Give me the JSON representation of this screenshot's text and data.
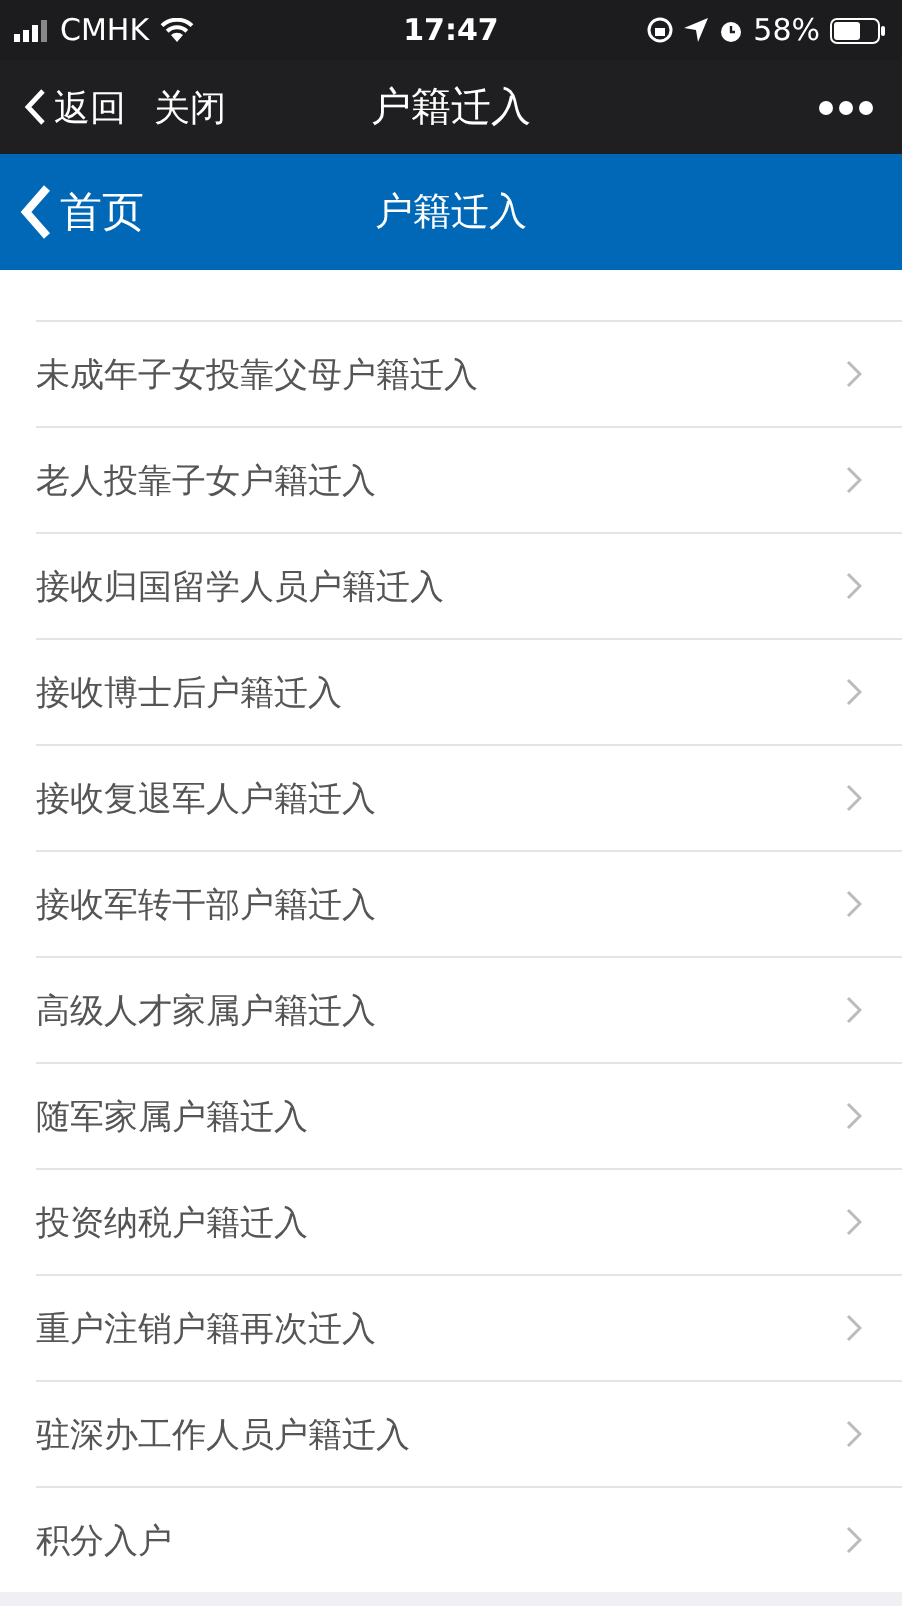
{
  "status_bar": {
    "carrier": "CMHK",
    "time": "17:47",
    "battery": "58%"
  },
  "wechat_bar": {
    "back": "返回",
    "close": "关闭",
    "title": "户籍迁入"
  },
  "header": {
    "back": "首页",
    "title": "户籍迁入"
  },
  "items": [
    {
      "label": "未成年子女投靠父母户籍迁入"
    },
    {
      "label": "老人投靠子女户籍迁入"
    },
    {
      "label": "接收归国留学人员户籍迁入"
    },
    {
      "label": "接收博士后户籍迁入"
    },
    {
      "label": "接收复退军人户籍迁入"
    },
    {
      "label": "接收军转干部户籍迁入"
    },
    {
      "label": "高级人才家属户籍迁入"
    },
    {
      "label": "随军家属户籍迁入"
    },
    {
      "label": "投资纳税户籍迁入"
    },
    {
      "label": "重户注销户籍再次迁入"
    },
    {
      "label": "驻深办工作人员户籍迁入"
    },
    {
      "label": "积分入户"
    }
  ]
}
